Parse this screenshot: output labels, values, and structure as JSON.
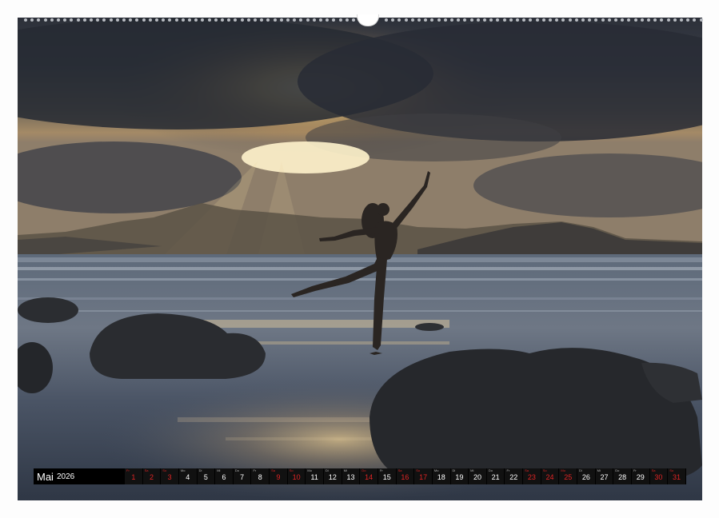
{
  "calendar": {
    "month": "Mai",
    "year": "2026",
    "days": [
      {
        "wd": "Fr",
        "d": "1",
        "red": true
      },
      {
        "wd": "Sa",
        "d": "2",
        "red": true
      },
      {
        "wd": "So",
        "d": "3",
        "red": true
      },
      {
        "wd": "Mo",
        "d": "4",
        "red": false
      },
      {
        "wd": "Di",
        "d": "5",
        "red": false
      },
      {
        "wd": "Mi",
        "d": "6",
        "red": false
      },
      {
        "wd": "Do",
        "d": "7",
        "red": false
      },
      {
        "wd": "Fr",
        "d": "8",
        "red": false
      },
      {
        "wd": "Sa",
        "d": "9",
        "red": true
      },
      {
        "wd": "So",
        "d": "10",
        "red": true
      },
      {
        "wd": "Mo",
        "d": "11",
        "red": false
      },
      {
        "wd": "Di",
        "d": "12",
        "red": false
      },
      {
        "wd": "Mi",
        "d": "13",
        "red": false
      },
      {
        "wd": "Do",
        "d": "14",
        "red": true
      },
      {
        "wd": "Fr",
        "d": "15",
        "red": false
      },
      {
        "wd": "Sa",
        "d": "16",
        "red": true
      },
      {
        "wd": "So",
        "d": "17",
        "red": true
      },
      {
        "wd": "Mo",
        "d": "18",
        "red": false
      },
      {
        "wd": "Di",
        "d": "19",
        "red": false
      },
      {
        "wd": "Mi",
        "d": "20",
        "red": false
      },
      {
        "wd": "Do",
        "d": "21",
        "red": false
      },
      {
        "wd": "Fr",
        "d": "22",
        "red": false
      },
      {
        "wd": "Sa",
        "d": "23",
        "red": true
      },
      {
        "wd": "So",
        "d": "24",
        "red": true
      },
      {
        "wd": "Mo",
        "d": "25",
        "red": true
      },
      {
        "wd": "Di",
        "d": "26",
        "red": false
      },
      {
        "wd": "Mi",
        "d": "27",
        "red": false
      },
      {
        "wd": "Do",
        "d": "28",
        "red": false
      },
      {
        "wd": "Fr",
        "d": "29",
        "red": false
      },
      {
        "wd": "Sa",
        "d": "30",
        "red": true
      },
      {
        "wd": "So",
        "d": "31",
        "red": true
      }
    ]
  },
  "colors": {
    "sky_dark": "#2b2f3a",
    "sun_glow": "#f6d58a",
    "sea": "#4a5566",
    "rock": "#2a2c30",
    "weekend_red": "#e02424"
  }
}
